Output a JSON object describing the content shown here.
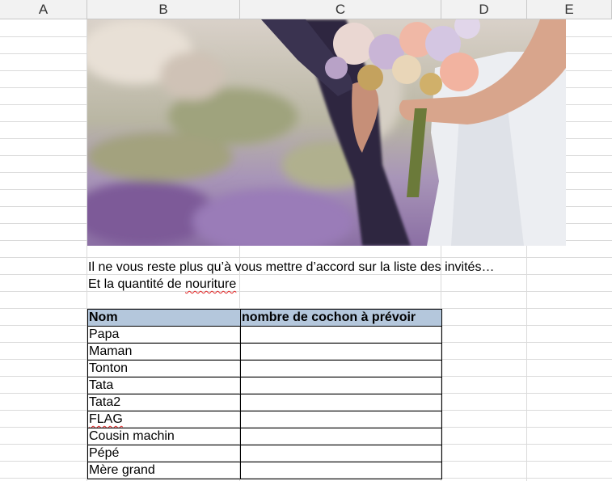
{
  "columns": [
    "A",
    "B",
    "C",
    "D",
    "E"
  ],
  "text": {
    "line1": "Il ne vous reste plus qu’à vous mettre d’accord sur la liste des invités…",
    "line2_prefix": "Et la quantité de ",
    "line2_flagged": "nouriture"
  },
  "table": {
    "headers": [
      "Nom",
      "nombre de cochon à prévoir"
    ],
    "rows": [
      {
        "nom": "Papa",
        "qte": ""
      },
      {
        "nom": "Maman",
        "qte": ""
      },
      {
        "nom": "Tonton",
        "qte": ""
      },
      {
        "nom": "Tata",
        "qte": ""
      },
      {
        "nom": "Tata2",
        "qte": ""
      },
      {
        "nom": "FLAG",
        "qte": ""
      },
      {
        "nom": "Cousin machin",
        "qte": ""
      },
      {
        "nom": "Pépé",
        "qte": ""
      },
      {
        "nom": "Mère grand",
        "qte": ""
      }
    ],
    "header_color": "#b4c7dc"
  },
  "image": {
    "subject": "wedding-couple-bouquet"
  }
}
